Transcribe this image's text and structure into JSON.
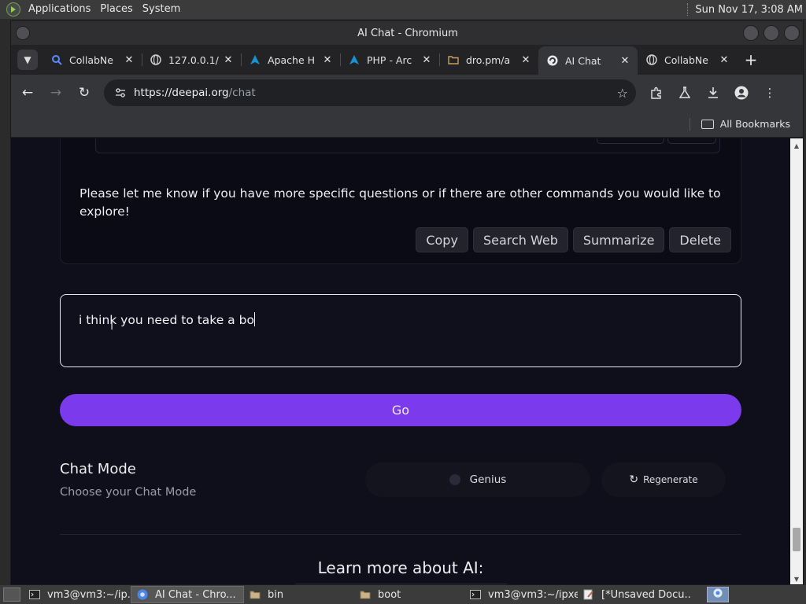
{
  "top_panel": {
    "menus": [
      "Applications",
      "Places",
      "System"
    ],
    "clock": "Sun Nov 17,  3:08 AM"
  },
  "window": {
    "title": "AI Chat - Chromium"
  },
  "tabs": [
    {
      "title": "CollabNe",
      "icon": "search-icon",
      "active": false
    },
    {
      "title": "127.0.0.1/",
      "icon": "globe-icon",
      "active": false
    },
    {
      "title": "Apache H",
      "icon": "arch-icon",
      "active": false
    },
    {
      "title": "PHP - Arc",
      "icon": "arch-icon",
      "active": false
    },
    {
      "title": "dro.pm/a",
      "icon": "folder-icon",
      "active": false
    },
    {
      "title": "AI Chat",
      "icon": "deepai-icon",
      "active": true
    },
    {
      "title": "CollabNe",
      "icon": "globe-icon",
      "active": false
    }
  ],
  "toolbar": {
    "url_host": "https://deepai.org",
    "url_path": "/chat"
  },
  "bookmarks": {
    "all_bookmarks_label": "All Bookmarks"
  },
  "page": {
    "message_text": "Please let me know if you have more specific questions or if there are other commands you would like to explore!",
    "message_actions": [
      "Copy",
      "Search Web",
      "Summarize",
      "Delete"
    ],
    "input_value": "i think you need to take a bo",
    "go_label": "Go",
    "chat_mode_title": "Chat Mode",
    "chat_mode_subtitle": "Choose your Chat Mode",
    "mode_option": "Genius",
    "regenerate_label": "Regenerate",
    "learn_more_heading": "Learn more about AI:"
  },
  "taskbar": {
    "tasks": [
      {
        "label": "vm3@vm3:~/ip...",
        "icon": "terminal-icon",
        "active": false
      },
      {
        "label": "AI Chat - Chro...",
        "icon": "chromium-icon",
        "active": true
      },
      {
        "label": "bin",
        "icon": "folder-icon",
        "active": false
      },
      {
        "label": "boot",
        "icon": "folder-icon",
        "active": false
      },
      {
        "label": "vm3@vm3:~/ipxe",
        "icon": "terminal-icon",
        "active": false
      },
      {
        "label": "[*Unsaved Docu...",
        "icon": "text-editor-icon",
        "active": false
      }
    ]
  },
  "colors": {
    "accent": "#7c3aed",
    "page_bg": "#0f0f1c"
  }
}
